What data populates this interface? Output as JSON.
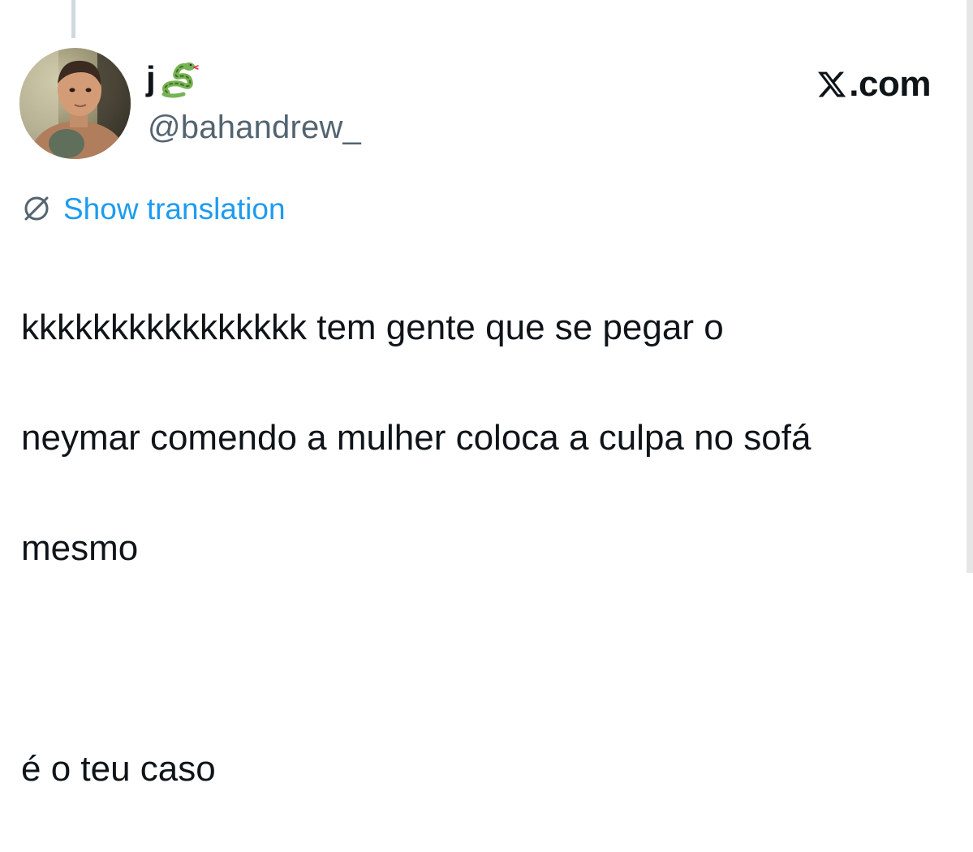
{
  "tweet": {
    "display_name": "j",
    "display_name_emoji": "snake-icon",
    "handle": "@bahandrew_",
    "brand_label": ".com",
    "brand_logo": "x-logo-icon",
    "translation_label": "Show translation",
    "body_lines": [
      "kkkkkkkkkkkkkkkk tem gente que se pegar o",
      "neymar comendo a mulher coloca a culpa no sofá",
      "mesmo",
      "",
      "é o teu caso"
    ]
  },
  "colors": {
    "link": "#1d9bf0",
    "handle": "#536471",
    "text": "#0f1419",
    "thread_line": "#cfd9de"
  }
}
